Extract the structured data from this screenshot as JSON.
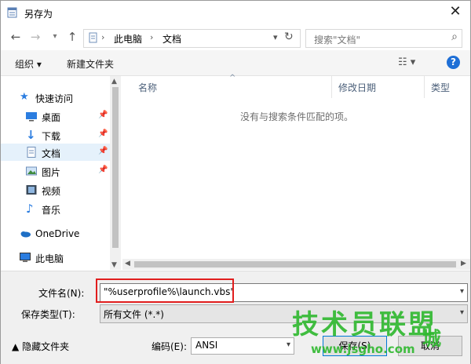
{
  "window": {
    "title": "另存为"
  },
  "navigation": {
    "path": [
      "此电脑",
      "文档"
    ],
    "search_placeholder": "搜索\"文档\""
  },
  "toolbar": {
    "organize_label": "组织 ▾",
    "new_folder_label": "新建文件夹"
  },
  "nav_pane": {
    "items": [
      {
        "label": "快速访问",
        "icon": "star-icon",
        "pinned": false
      },
      {
        "label": "桌面",
        "icon": "desktop-icon",
        "pinned": true
      },
      {
        "label": "下载",
        "icon": "download-icon",
        "pinned": true
      },
      {
        "label": "文档",
        "icon": "document-icon",
        "pinned": true,
        "selected": true
      },
      {
        "label": "图片",
        "icon": "pictures-icon",
        "pinned": true
      },
      {
        "label": "视频",
        "icon": "video-icon",
        "pinned": false
      },
      {
        "label": "音乐",
        "icon": "music-icon",
        "pinned": false
      },
      {
        "label": "OneDrive",
        "icon": "onedrive-icon",
        "pinned": false
      },
      {
        "label": "此电脑",
        "icon": "pc-icon",
        "pinned": false
      }
    ]
  },
  "content": {
    "columns": [
      "名称",
      "修改日期",
      "类型"
    ],
    "empty_message": "没有与搜索条件匹配的项。"
  },
  "bottom": {
    "filename_label": "文件名(N):",
    "filename_value": "\"%userprofile%\\launch.vbs\"",
    "filetype_label": "保存类型(T):",
    "filetype_value": "所有文件  (*.*)",
    "hide_folders_label": "隐藏文件夹",
    "encoding_label": "编码(E):",
    "encoding_value": "ANSI",
    "save_label": "保存(S)",
    "cancel_label": "取消"
  },
  "watermark": {
    "text": "技术员联盟",
    "url": "www.jsgho.com",
    "suffix": "城"
  },
  "colors": {
    "accent": "#1e6fd6",
    "highlight": "#e11e1e",
    "watermark": "#2eb82e",
    "selection": "#e5f1fb"
  }
}
